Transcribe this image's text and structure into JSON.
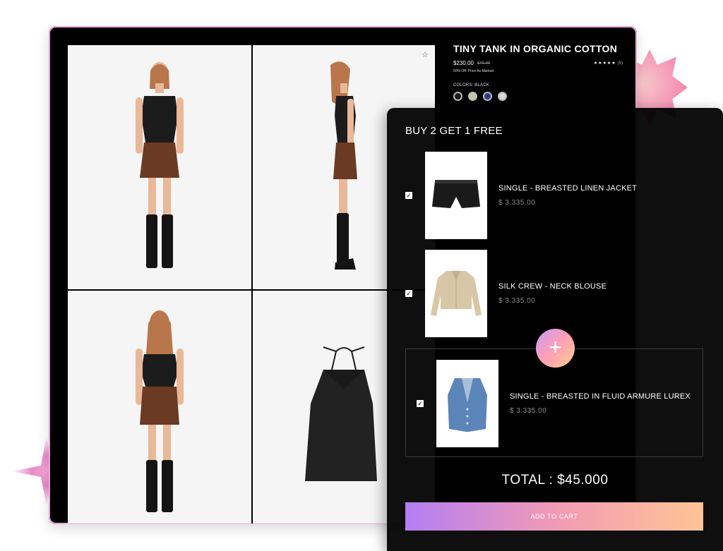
{
  "product": {
    "title": "TINY TANK IN ORGANIC COTTON",
    "price": "$230.00",
    "old_price": "$49.95",
    "rating_stars": "★★★★★",
    "rating_count": "(5)",
    "discount_note": "50% Off: Price As Marked",
    "colors_label": "COLORS: BLACK",
    "swatches": [
      "#1a1a1a",
      "#c8c8a0",
      "#2b3a8a",
      "#d8d8d8"
    ],
    "wishlist_icon": "star-outline-icon"
  },
  "bundle": {
    "title": "BUY 2 GET 1 FREE",
    "items": [
      {
        "name": "SINGLE - BREASTED LINEN JACKET",
        "price": "$ 3.335.00",
        "checked": true
      },
      {
        "name": "SILK CREW - NECK BLOUSE",
        "price": "$ 3.335.00",
        "checked": true
      },
      {
        "name": "SINGLE - BREASTED IN FLUID ARMURE LUREX",
        "price": "$ 3.335.00",
        "checked": true
      }
    ],
    "plus_icon": "plus-icon",
    "total": "TOTAL : $45.000",
    "add_to_cart": "ADD TO CART"
  },
  "theme": {
    "accent_gradient": [
      "#b37ef4",
      "#f19ab5",
      "#ffc594"
    ]
  }
}
